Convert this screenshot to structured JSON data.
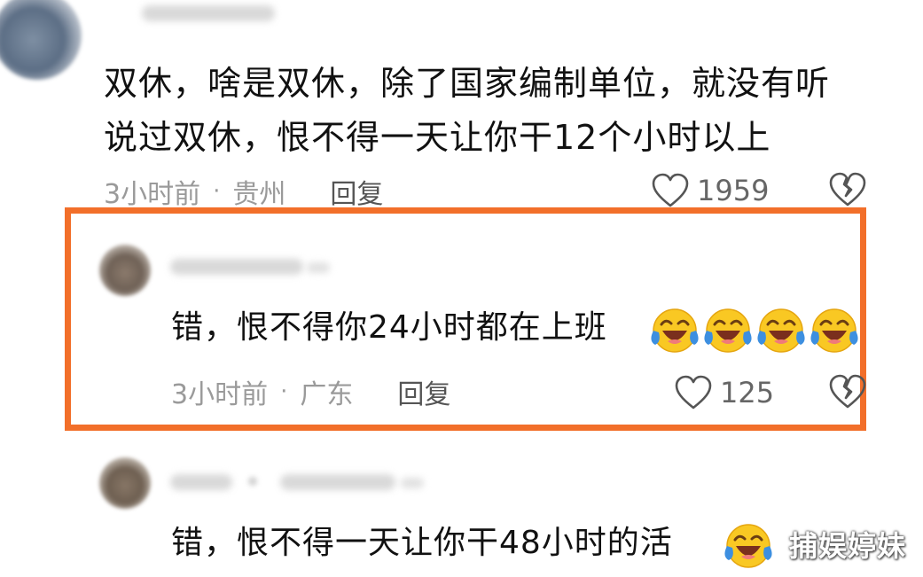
{
  "comments": [
    {
      "text_line1": "双休，啥是双休，除了国家编制单位，就没有听",
      "text_line2": "说过双休，恨不得一天让你干12个小时以上",
      "time": "3小时前",
      "dot": "·",
      "location": "贵州",
      "reply_label": "回复",
      "likes": "1959"
    },
    {
      "text": "错，恨不得你24小时都在上班",
      "emoji_count": 4,
      "time": "3小时前",
      "dot": "·",
      "location": "广东",
      "reply_label": "回复",
      "likes": "125"
    },
    {
      "text": "错，恨不得一天让你干48小时的活"
    }
  ],
  "colors": {
    "highlight": "#f26f2a",
    "meta": "#9a9a9a",
    "emoji_yellow": "#f9c823",
    "tear_blue": "#3d8fe0"
  },
  "icons": {
    "like": "heart-outline-icon",
    "dislike": "broken-heart-icon",
    "reaction": "laughing-crying-emoji"
  },
  "watermark": "捕娱婷妹"
}
